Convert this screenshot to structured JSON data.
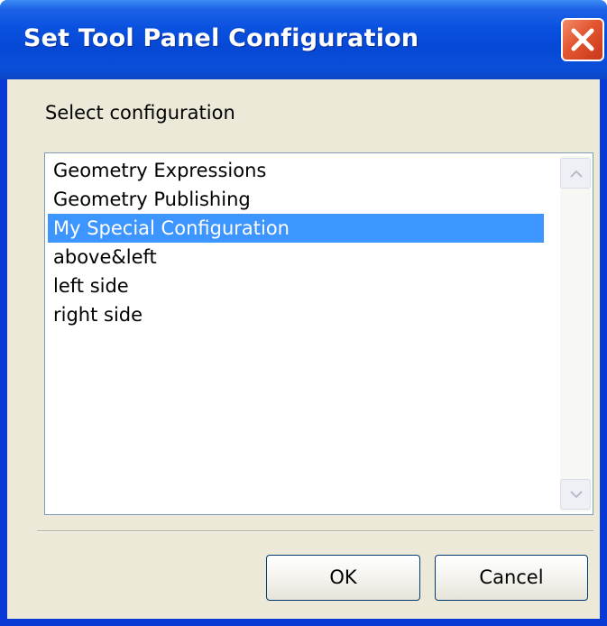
{
  "window": {
    "title": "Set Tool Panel Configuration"
  },
  "dialog": {
    "prompt": "Select configuration",
    "configurations": [
      "Geometry Expressions",
      "Geometry Publishing",
      "My Special Configuration",
      "above&left",
      "left side",
      "right side"
    ],
    "selected_item": "My Special Configuration",
    "ok_label": "OK",
    "cancel_label": "Cancel"
  },
  "icons": {
    "close": "close-icon",
    "scroll_up": "chevron-up-icon",
    "scroll_down": "chevron-down-icon"
  },
  "colors": {
    "titlebar": "#0548d6",
    "close_button": "#e3552f",
    "selection": "#3d95ff",
    "dialog_background": "#ece9d8"
  }
}
